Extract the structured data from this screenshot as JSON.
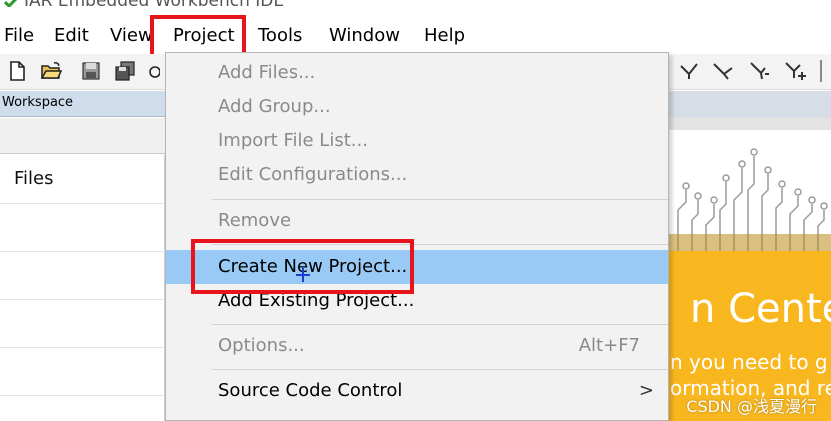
{
  "app": {
    "title": "IAR Embedded Workbench IDE"
  },
  "menubar": {
    "items": [
      {
        "label": "File"
      },
      {
        "label": "Edit"
      },
      {
        "label": "View"
      },
      {
        "label": "Project"
      },
      {
        "label": "Tools"
      },
      {
        "label": "Window"
      },
      {
        "label": "Help"
      }
    ]
  },
  "toolbar": {
    "icons": [
      "new-file-icon",
      "open-folder-icon",
      "save-icon",
      "save-all-icon",
      "debug-tool-icon",
      "breakpoint-icon",
      "step-icon",
      "run-to-cursor-icon",
      "add-watch-icon"
    ]
  },
  "workspace": {
    "header": "Workspace",
    "files_label": "Files"
  },
  "project_menu": {
    "items": [
      {
        "label": "Add Files...",
        "enabled": false
      },
      {
        "label": "Add Group...",
        "enabled": false
      },
      {
        "label": "Import File List...",
        "enabled": false
      },
      {
        "label": "Edit Configurations...",
        "enabled": false
      },
      {
        "label": "Remove",
        "enabled": false
      },
      {
        "label": "Create New Project...",
        "enabled": true,
        "highlighted": true
      },
      {
        "label": "Add Existing Project...",
        "enabled": true
      },
      {
        "label": "Options...",
        "enabled": false,
        "shortcut": "Alt+F7"
      },
      {
        "label": "Source Code Control",
        "enabled": true,
        "submenu_arrow": ">"
      }
    ]
  },
  "banner": {
    "heading": "n Cente",
    "line1": "n you need to g",
    "line2": "ormation, and re"
  },
  "watermark": "CSDN @浅夏漫行",
  "colors": {
    "highlight": "#99c9f5",
    "annotation_red": "#e8141b",
    "banner_orange": "#f9b71f",
    "workspace_header": "#cfdceb",
    "disabled_text": "#8a8a8a"
  }
}
